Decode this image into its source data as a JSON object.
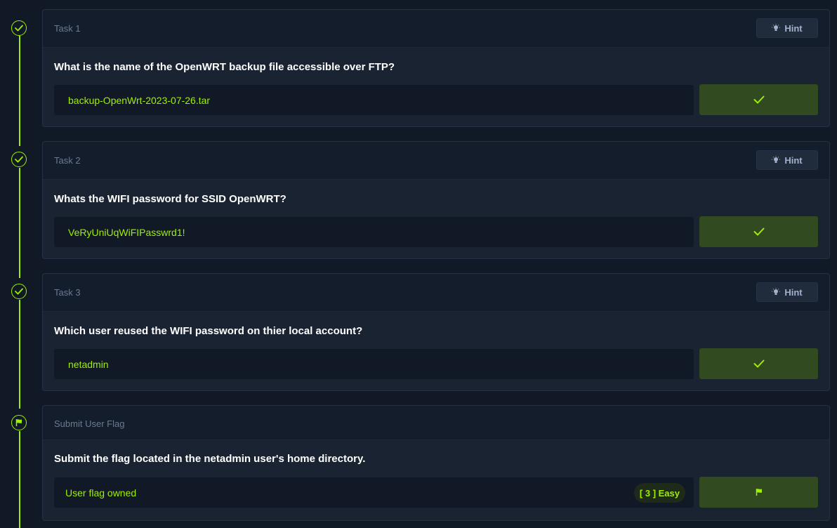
{
  "tasks": [
    {
      "label": "Task 1",
      "hint_label": "Hint",
      "question": "What is the name of the OpenWRT backup file accessible over FTP?",
      "answer": "backup-OpenWrt-2023-07-26.tar",
      "status": "completed"
    },
    {
      "label": "Task 2",
      "hint_label": "Hint",
      "question": "Whats the WIFI password for SSID OpenWRT?",
      "answer": "VeRyUniUqWiFIPasswrd1!",
      "status": "completed"
    },
    {
      "label": "Task 3",
      "hint_label": "Hint",
      "question": "Which user reused the WIFI password on thier local account?",
      "answer": "netadmin",
      "status": "completed"
    }
  ],
  "flag_task": {
    "label": "Submit User Flag",
    "question": "Submit the flag located in the netadmin user's home directory.",
    "answer": "User flag owned",
    "badge": "[ 3 ] Easy",
    "status": "owned"
  },
  "icons": {
    "completed": "check-icon",
    "hint": "lightbulb-icon",
    "flag": "flag-icon"
  },
  "colors": {
    "accent": "#9fef00",
    "background": "#111927",
    "card": "#1a2332",
    "card_header": "#141d2b",
    "submit_button": "#324a1f",
    "muted_text": "#6b7a93"
  }
}
